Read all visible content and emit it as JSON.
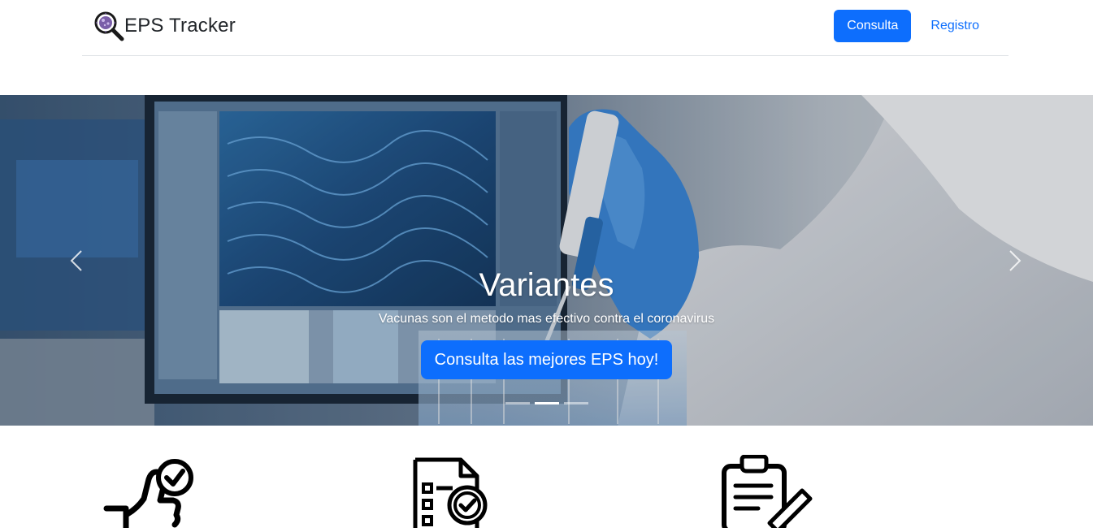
{
  "brand": {
    "name": "EPS Tracker",
    "logo_icon": "virus-magnifier-icon"
  },
  "nav": {
    "items": [
      {
        "label": "Consulta",
        "active": true
      },
      {
        "label": "Registro",
        "active": false
      }
    ]
  },
  "carousel": {
    "title": "Variantes",
    "subtitle": "Vacunas son el metodo mas efectivo contra el coronavirus",
    "cta_label": "Consulta las mejores EPS hoy!",
    "prev_icon": "chevron-left-icon",
    "next_icon": "chevron-right-icon",
    "slide_count": 3,
    "active_slide": 2
  },
  "features": [
    {
      "icon": "thumbs-up-check-icon"
    },
    {
      "icon": "document-magnifier-check-icon"
    },
    {
      "icon": "clipboard-pen-icon"
    }
  ],
  "colors": {
    "primary": "#0d6efd",
    "text": "#212529",
    "divider": "#dee2e6"
  }
}
